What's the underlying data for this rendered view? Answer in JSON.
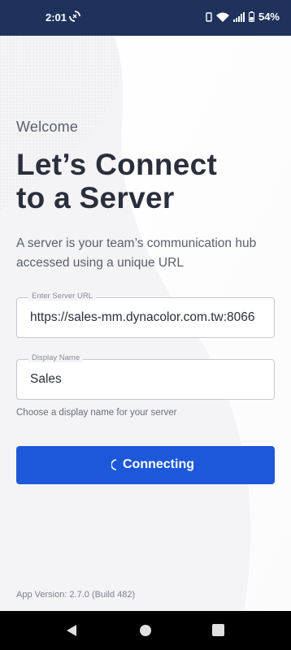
{
  "status_bar": {
    "time": "2:01",
    "battery": "54%",
    "icons": [
      "sync-icon",
      "wifi-icon",
      "signal-icon",
      "battery-icon"
    ],
    "background": "#1e325c"
  },
  "screen": {
    "welcome": "Welcome",
    "headline_line1": "Let’s Connect",
    "headline_line2": "to a Server",
    "subtext": "A server is your team’s communication hub accessed using a unique URL"
  },
  "form": {
    "server_url_label": "Enter Server URL",
    "server_url_value": "https://sales-mm.dynacolor.com.tw:8066",
    "display_name_label": "Display Name",
    "display_name_value": "Sales",
    "display_name_helper": "Choose a display name for your server"
  },
  "connect_button": {
    "label": "Connecting",
    "color": "#1c58d9"
  },
  "footer": {
    "app_version": "App Version: 2.7.0 (Build 482)"
  },
  "nav_bar": {
    "icons": [
      "back-icon",
      "home-icon",
      "recents-icon"
    ]
  }
}
